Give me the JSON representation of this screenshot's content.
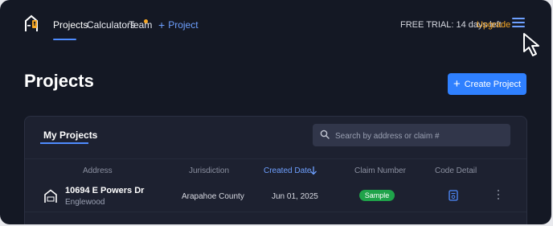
{
  "nav": {
    "items": [
      {
        "label": "Projects",
        "active": true
      },
      {
        "label": "Calculators",
        "active": false
      },
      {
        "label": "Team",
        "active": false,
        "has_notification": true
      }
    ],
    "add_project_label": "Project",
    "trial_text": "FREE TRIAL: 14 days left",
    "upgrade_label": "Upgrade"
  },
  "page": {
    "title": "Projects",
    "create_button_label": "Create Project"
  },
  "card": {
    "tab_label": "My Projects",
    "search": {
      "placeholder": "Search by address or claim #",
      "value": ""
    },
    "columns": [
      "Address",
      "Jurisdiction",
      "Created Date",
      "Claim Number",
      "Code Detail"
    ],
    "sorted_column": "Created Date",
    "sort_direction": "descending",
    "rows": [
      {
        "address": "10694 E Powers Dr",
        "city": "Englewood",
        "jurisdiction": "Arapahoe County",
        "created_date": "Jun 01, 2025",
        "claim_badge": "Sample"
      }
    ]
  },
  "colors": {
    "background": "#141824",
    "card": "#1d2130",
    "accent": "#2f80ff",
    "upgrade": "#f6a623",
    "badge": "#1fa34a"
  },
  "icons": [
    "house-logo-icon",
    "plus-icon",
    "hamburger-menu-icon",
    "cursor-icon",
    "search-icon",
    "arrow-down-icon",
    "property-icon",
    "document-icon",
    "kebab-icon"
  ]
}
